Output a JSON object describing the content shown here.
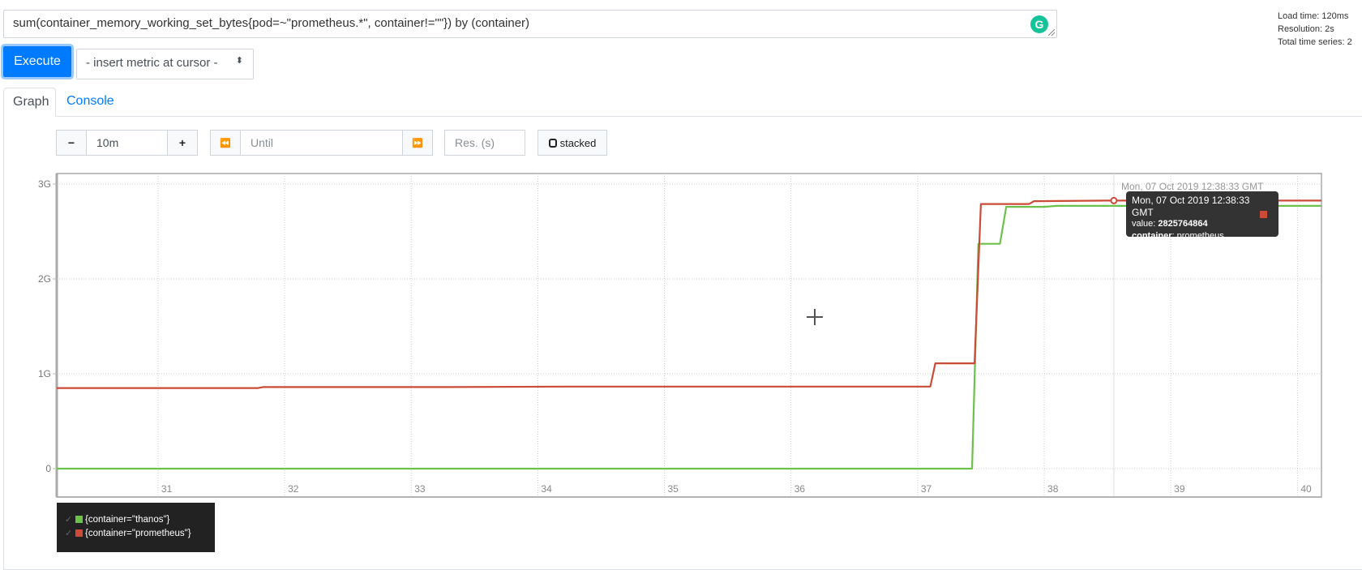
{
  "query": {
    "expression": "sum(container_memory_working_set_bytes{pod=~\"prometheus.*\", container!=\"\"}) by (container)",
    "grammarly_icon": "G"
  },
  "stats": {
    "load_time": "Load time: 120ms",
    "resolution": "Resolution: 2s",
    "total_series": "Total time series: 2"
  },
  "actions": {
    "execute_label": "Execute",
    "metric_select_value": "- insert metric at cursor -",
    "metric_select_caret": "⬍"
  },
  "tabs": [
    {
      "label": "Graph",
      "active": true
    },
    {
      "label": "Console",
      "active": false
    }
  ],
  "graph_controls": {
    "range_minus": "−",
    "range_value": "10m",
    "range_plus": "+",
    "back_icon": "⏪",
    "until_placeholder": "Until",
    "forward_icon": "⏩",
    "resolution_placeholder": "Res. (s)",
    "stacked_label": "stacked"
  },
  "tooltip": {
    "hover_time_label": "Mon, 07 Oct 2019 12:38:33 GMT",
    "date": "Mon, 07 Oct 2019 12:38:33 GMT",
    "value_label": "value: ",
    "value": "2825764864",
    "label_key": "container",
    "label_value": ": prometheus",
    "swatch_color": "#cc4b37"
  },
  "legend": [
    {
      "check": "✓",
      "label": "{container=\"thanos\"}",
      "color": "#6cc14b"
    },
    {
      "check": "✓",
      "label": "{container=\"prometheus\"}",
      "color": "#cc4b37"
    }
  ],
  "chart_data": {
    "type": "line",
    "title": "",
    "xlabel": "",
    "ylabel": "",
    "x_unit": "minute of hour 12 (GMT)",
    "xlim": [
      30.2,
      40.19
    ],
    "ylim": [
      0,
      3080000000.0
    ],
    "x_ticks": [
      31,
      32,
      33,
      34,
      35,
      36,
      37,
      38,
      39,
      40
    ],
    "x_tick_labels": [
      "31",
      "32",
      "33",
      "34",
      "35",
      "36",
      "37",
      "38",
      "39",
      "40"
    ],
    "y_ticks": [
      0,
      1000000000.0,
      2000000000.0,
      3000000000.0
    ],
    "y_tick_labels": [
      "0",
      "1G",
      "2G",
      "3G"
    ],
    "grid": true,
    "legend_position": "bottom-left",
    "series": [
      {
        "name": "{container=\"thanos\"}",
        "color": "#6cc14b",
        "x": [
          30.2,
          37.43,
          37.48,
          37.65,
          37.7,
          38.0,
          38.1,
          40.19
        ],
        "values": [
          0,
          0,
          2370000000.0,
          2370000000.0,
          2760000000.0,
          2760000000.0,
          2770000000.0,
          2770000000.0
        ]
      },
      {
        "name": "{container=\"prometheus\"}",
        "color": "#cc4b37",
        "x": [
          30.2,
          31.79,
          31.83,
          33.3,
          34.2,
          36.0,
          37.1,
          37.14,
          37.45,
          37.5,
          37.88,
          37.92,
          38.5,
          40.19
        ],
        "values": [
          850000000.0,
          850000000.0,
          860000000.0,
          860000000.0,
          865000000.0,
          865000000.0,
          865000000.0,
          1110000000.0,
          1110000000.0,
          2790000000.0,
          2790000000.0,
          2820000000.0,
          2825800000.0,
          2825800000.0
        ]
      }
    ],
    "hover_point": {
      "series": "{container=\"prometheus\"}",
      "x": 38.55,
      "value": 2825764864
    }
  }
}
